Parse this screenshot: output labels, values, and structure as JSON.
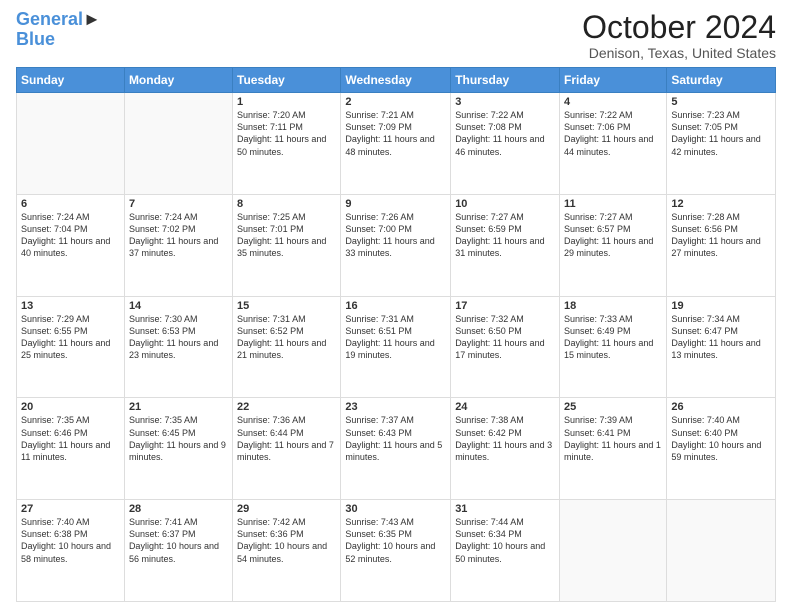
{
  "header": {
    "logo_line1": "General",
    "logo_line2": "Blue",
    "month": "October 2024",
    "location": "Denison, Texas, United States"
  },
  "days_of_week": [
    "Sunday",
    "Monday",
    "Tuesday",
    "Wednesday",
    "Thursday",
    "Friday",
    "Saturday"
  ],
  "weeks": [
    [
      {
        "day": "",
        "info": ""
      },
      {
        "day": "",
        "info": ""
      },
      {
        "day": "1",
        "info": "Sunrise: 7:20 AM\nSunset: 7:11 PM\nDaylight: 11 hours and 50 minutes."
      },
      {
        "day": "2",
        "info": "Sunrise: 7:21 AM\nSunset: 7:09 PM\nDaylight: 11 hours and 48 minutes."
      },
      {
        "day": "3",
        "info": "Sunrise: 7:22 AM\nSunset: 7:08 PM\nDaylight: 11 hours and 46 minutes."
      },
      {
        "day": "4",
        "info": "Sunrise: 7:22 AM\nSunset: 7:06 PM\nDaylight: 11 hours and 44 minutes."
      },
      {
        "day": "5",
        "info": "Sunrise: 7:23 AM\nSunset: 7:05 PM\nDaylight: 11 hours and 42 minutes."
      }
    ],
    [
      {
        "day": "6",
        "info": "Sunrise: 7:24 AM\nSunset: 7:04 PM\nDaylight: 11 hours and 40 minutes."
      },
      {
        "day": "7",
        "info": "Sunrise: 7:24 AM\nSunset: 7:02 PM\nDaylight: 11 hours and 37 minutes."
      },
      {
        "day": "8",
        "info": "Sunrise: 7:25 AM\nSunset: 7:01 PM\nDaylight: 11 hours and 35 minutes."
      },
      {
        "day": "9",
        "info": "Sunrise: 7:26 AM\nSunset: 7:00 PM\nDaylight: 11 hours and 33 minutes."
      },
      {
        "day": "10",
        "info": "Sunrise: 7:27 AM\nSunset: 6:59 PM\nDaylight: 11 hours and 31 minutes."
      },
      {
        "day": "11",
        "info": "Sunrise: 7:27 AM\nSunset: 6:57 PM\nDaylight: 11 hours and 29 minutes."
      },
      {
        "day": "12",
        "info": "Sunrise: 7:28 AM\nSunset: 6:56 PM\nDaylight: 11 hours and 27 minutes."
      }
    ],
    [
      {
        "day": "13",
        "info": "Sunrise: 7:29 AM\nSunset: 6:55 PM\nDaylight: 11 hours and 25 minutes."
      },
      {
        "day": "14",
        "info": "Sunrise: 7:30 AM\nSunset: 6:53 PM\nDaylight: 11 hours and 23 minutes."
      },
      {
        "day": "15",
        "info": "Sunrise: 7:31 AM\nSunset: 6:52 PM\nDaylight: 11 hours and 21 minutes."
      },
      {
        "day": "16",
        "info": "Sunrise: 7:31 AM\nSunset: 6:51 PM\nDaylight: 11 hours and 19 minutes."
      },
      {
        "day": "17",
        "info": "Sunrise: 7:32 AM\nSunset: 6:50 PM\nDaylight: 11 hours and 17 minutes."
      },
      {
        "day": "18",
        "info": "Sunrise: 7:33 AM\nSunset: 6:49 PM\nDaylight: 11 hours and 15 minutes."
      },
      {
        "day": "19",
        "info": "Sunrise: 7:34 AM\nSunset: 6:47 PM\nDaylight: 11 hours and 13 minutes."
      }
    ],
    [
      {
        "day": "20",
        "info": "Sunrise: 7:35 AM\nSunset: 6:46 PM\nDaylight: 11 hours and 11 minutes."
      },
      {
        "day": "21",
        "info": "Sunrise: 7:35 AM\nSunset: 6:45 PM\nDaylight: 11 hours and 9 minutes."
      },
      {
        "day": "22",
        "info": "Sunrise: 7:36 AM\nSunset: 6:44 PM\nDaylight: 11 hours and 7 minutes."
      },
      {
        "day": "23",
        "info": "Sunrise: 7:37 AM\nSunset: 6:43 PM\nDaylight: 11 hours and 5 minutes."
      },
      {
        "day": "24",
        "info": "Sunrise: 7:38 AM\nSunset: 6:42 PM\nDaylight: 11 hours and 3 minutes."
      },
      {
        "day": "25",
        "info": "Sunrise: 7:39 AM\nSunset: 6:41 PM\nDaylight: 11 hours and 1 minute."
      },
      {
        "day": "26",
        "info": "Sunrise: 7:40 AM\nSunset: 6:40 PM\nDaylight: 10 hours and 59 minutes."
      }
    ],
    [
      {
        "day": "27",
        "info": "Sunrise: 7:40 AM\nSunset: 6:38 PM\nDaylight: 10 hours and 58 minutes."
      },
      {
        "day": "28",
        "info": "Sunrise: 7:41 AM\nSunset: 6:37 PM\nDaylight: 10 hours and 56 minutes."
      },
      {
        "day": "29",
        "info": "Sunrise: 7:42 AM\nSunset: 6:36 PM\nDaylight: 10 hours and 54 minutes."
      },
      {
        "day": "30",
        "info": "Sunrise: 7:43 AM\nSunset: 6:35 PM\nDaylight: 10 hours and 52 minutes."
      },
      {
        "day": "31",
        "info": "Sunrise: 7:44 AM\nSunset: 6:34 PM\nDaylight: 10 hours and 50 minutes."
      },
      {
        "day": "",
        "info": ""
      },
      {
        "day": "",
        "info": ""
      }
    ]
  ]
}
